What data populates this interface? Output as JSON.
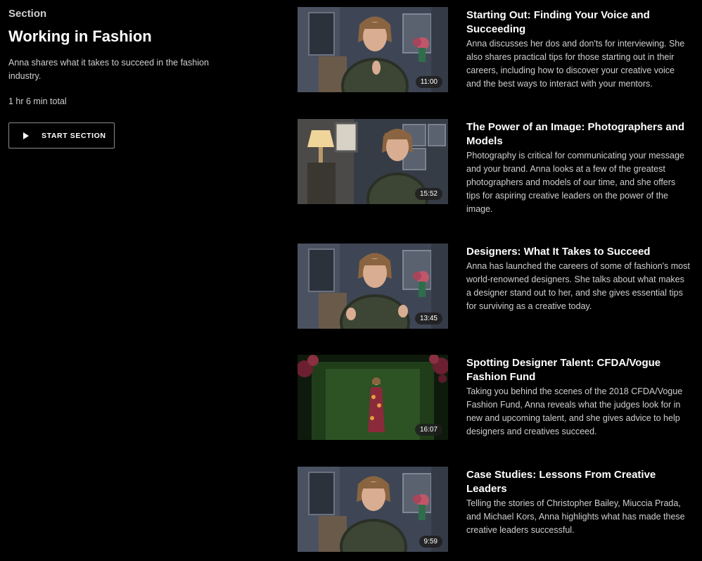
{
  "section": {
    "label": "Section",
    "title": "Working in Fashion",
    "description": "Anna shares what it takes to succeed in the fashion industry.",
    "total": "1 hr 6 min total",
    "start_button": "START SECTION"
  },
  "lessons": [
    {
      "title": "Starting Out: Finding Your Voice and Succeeding",
      "description": "Anna discusses her dos and don'ts for interviewing. She also shares practical tips for those starting out in their careers, including how to discover your creative voice and the best ways to interact with your mentors.",
      "duration": "11:00"
    },
    {
      "title": "The Power of an Image: Photographers and Models",
      "description": "Photography is critical for communicating your message and your brand. Anna looks at a few of the greatest photographers and models of our time, and she offers tips for aspiring creative leaders on the power of the image.",
      "duration": "15:52"
    },
    {
      "title": "Designers: What It Takes to Succeed",
      "description": "Anna has launched the careers of some of fashion's most world-renowned designers. She talks about what makes a designer stand out to her, and she gives essential tips for surviving as a creative today.",
      "duration": "13:45"
    },
    {
      "title": "Spotting Designer Talent: CFDA/Vogue Fashion Fund",
      "description": "Taking you behind the scenes of the 2018 CFDA/Vogue Fashion Fund, Anna reveals what the judges look for in new and upcoming talent, and she gives advice to help designers and creatives succeed.",
      "duration": "16:07"
    },
    {
      "title": "Case Studies: Lessons From Creative Leaders",
      "description": "Telling the stories of Christopher Bailey, Miuccia Prada, and Michael Kors, Anna highlights what has made these creative leaders successful.",
      "duration": "9:59"
    }
  ],
  "colors": {
    "background": "#000000",
    "text_primary": "#ffffff",
    "text_secondary": "#cfcfcf",
    "button_border": "#8a8a8a"
  },
  "icons": {
    "start_button": "play-icon"
  }
}
